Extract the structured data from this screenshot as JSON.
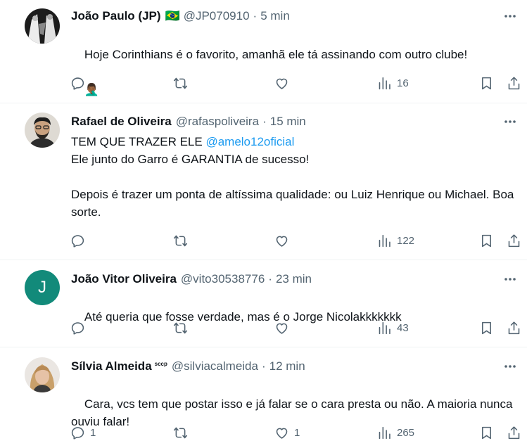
{
  "tweets": [
    {
      "name": "João Paulo (JP)",
      "badge": "🇧🇷",
      "handle": "@JP070910",
      "sep": "·",
      "time": "5 min",
      "text": "Hoje Corinthians é o favorito, amanhã ele tá assinando com outro clube!",
      "emoji": "🤦🏾‍♂️",
      "replies": "",
      "reposts": "",
      "likes": "",
      "views": "16"
    },
    {
      "name": "Rafael de Oliveira",
      "handle": "@rafaspoliveira",
      "sep": "·",
      "time": "15 min",
      "text_before_mention": "TEM QUE TRAZER ELE ",
      "mention": "@amelo12oficial",
      "text_after_mention": "\nEle junto do Garro é GARANTIA de sucesso!\n\nDepois é trazer um ponta de altíssima qualidade: ou Luiz Henrique ou Michael. Boa sorte.",
      "replies": "",
      "reposts": "",
      "likes": "",
      "views": "122"
    },
    {
      "name": "João Vitor Oliveira",
      "avatar_letter": "J",
      "handle": "@vito30538776",
      "sep": "·",
      "time": "23 min",
      "text": "Até queria que fosse verdade, mas é o Jorge Nicolakkkkkkk",
      "replies": "",
      "reposts": "",
      "likes": "",
      "views": "43"
    },
    {
      "name": "Sílvia Almeida",
      "badge": "sccp",
      "handle": "@silviacalmeida",
      "sep": "·",
      "time": "12 min",
      "text": "Cara, vcs tem que postar isso e já falar se o cara presta ou não. A maioria nunca ouviu falar!",
      "replies": "1",
      "reposts": "",
      "likes": "1",
      "views": "265"
    }
  ],
  "icons": {
    "reply": "reply-icon",
    "repost": "repost-icon",
    "like": "heart-icon",
    "views": "views-chart-icon",
    "bookmark": "bookmark-icon",
    "share": "share-icon",
    "more": "more-dots-icon"
  },
  "colors": {
    "text": "#0f1419",
    "secondary": "#536471",
    "link": "#1d9bf0",
    "avatar_letter_bg": "#128a7a",
    "divider": "#eff3f4"
  }
}
